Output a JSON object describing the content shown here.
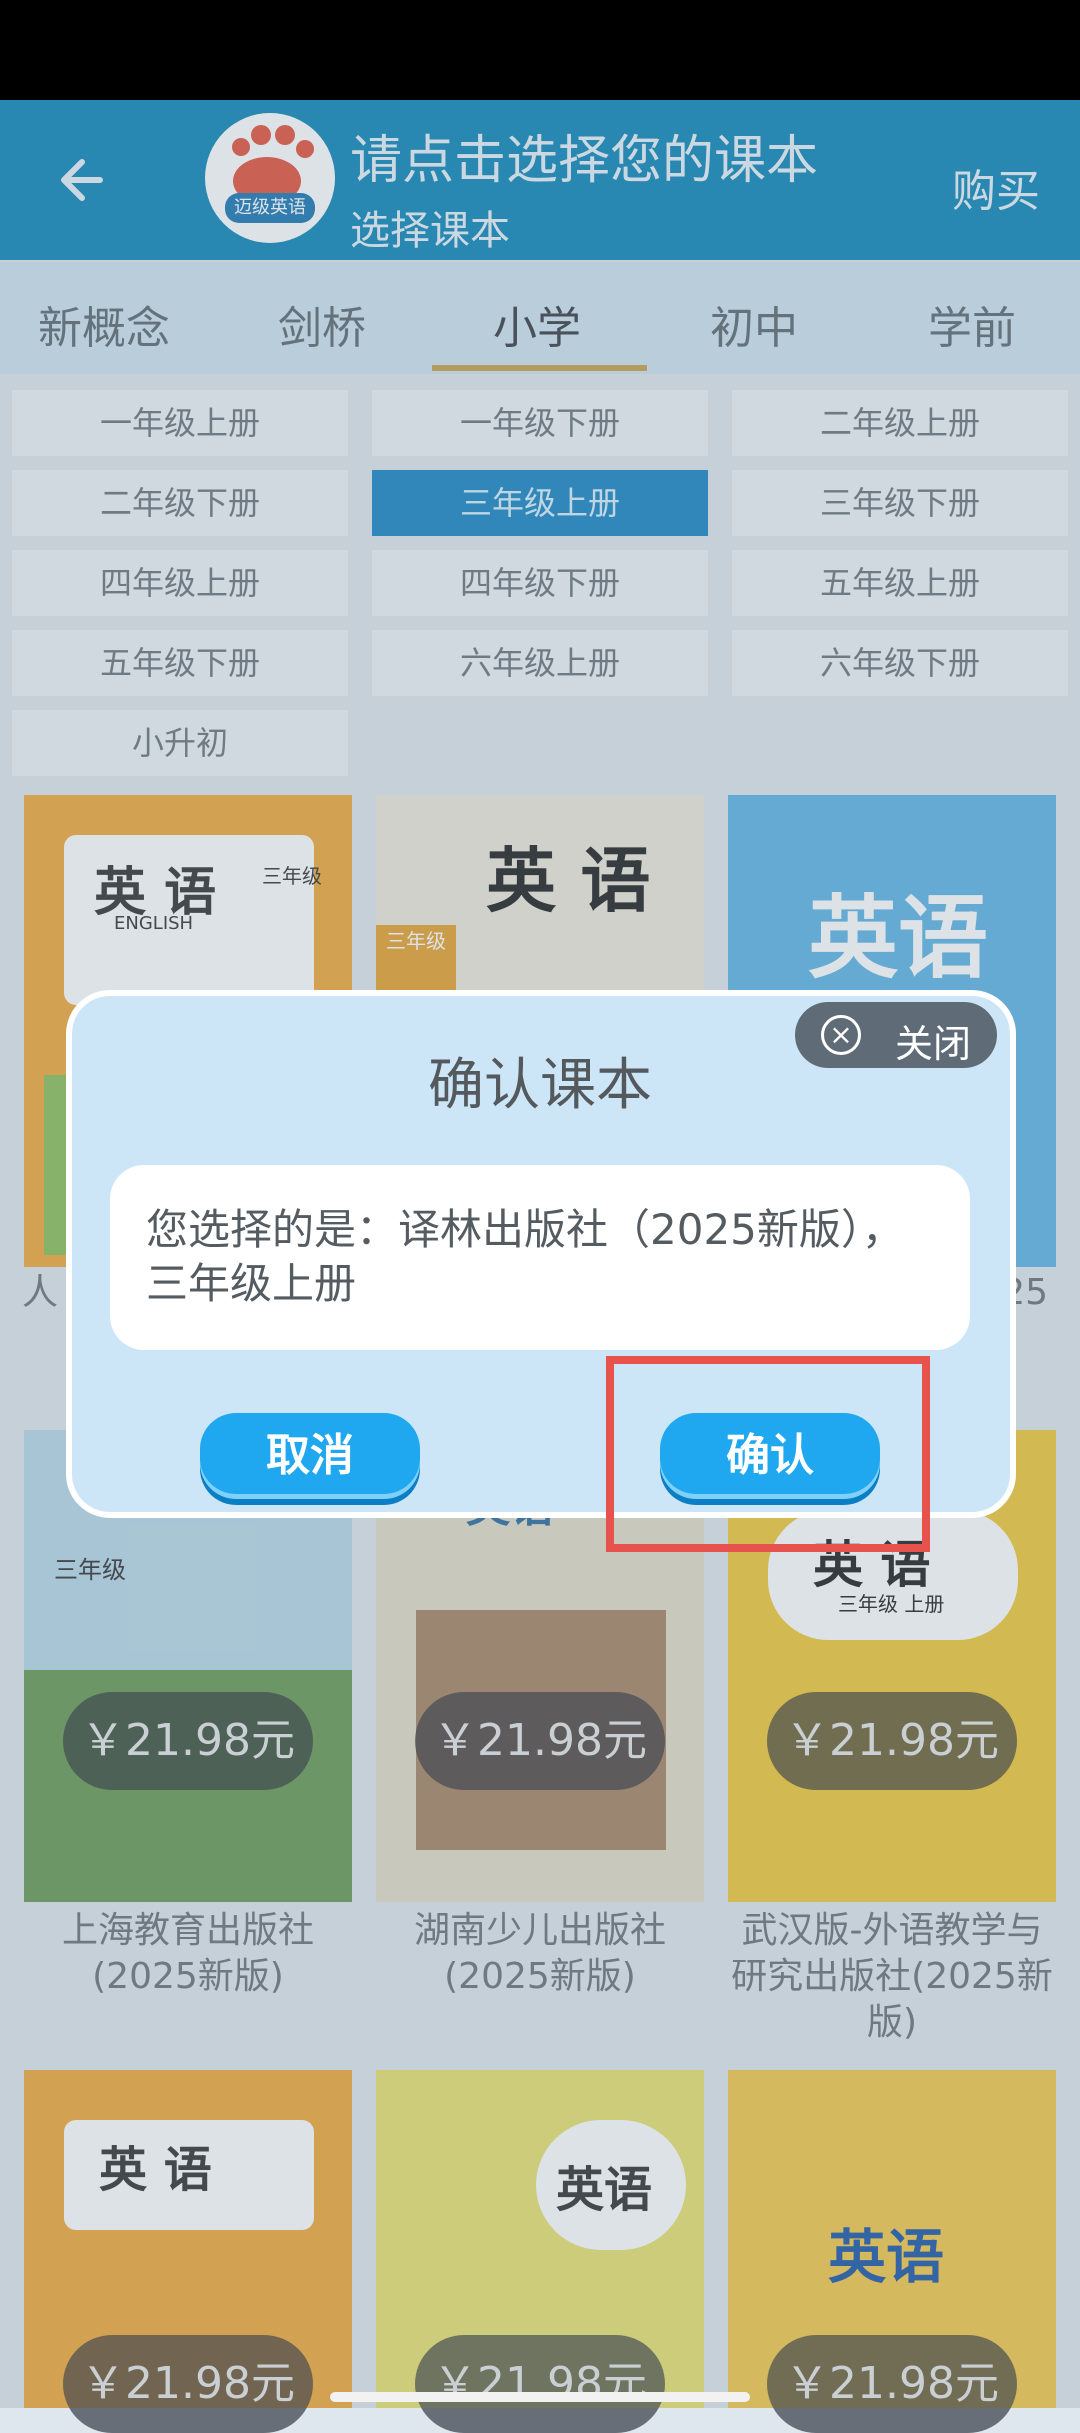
{
  "header": {
    "title": "请点击选择您的课本",
    "subtitle": "选择课本",
    "buy_label": "购买",
    "logo_text": "迈级英语"
  },
  "tabs": [
    "新概念",
    "剑桥",
    "小学",
    "初中",
    "学前"
  ],
  "active_tab": "小学",
  "grades": [
    "一年级上册",
    "一年级下册",
    "二年级上册",
    "二年级下册",
    "三年级上册",
    "三年级下册",
    "四年级上册",
    "四年级下册",
    "五年级上册",
    "五年级下册",
    "六年级上册",
    "六年级下册",
    "小升初"
  ],
  "selected_grade": "三年级上册",
  "books_row2": [
    {
      "publisher": "上海教育出版社(2025新版)",
      "price": "￥21.98元"
    },
    {
      "publisher": "湖南少儿出版社(2025新版)",
      "price": "￥21.98元"
    },
    {
      "publisher": "武汉版-外语教学与研究出版社(2025新版)",
      "price": "￥21.98元"
    }
  ],
  "books_row3": [
    {
      "price": "￥21.98元"
    },
    {
      "price": "￥21.98元"
    },
    {
      "price": "￥21.98元"
    }
  ],
  "row1_fragments": {
    "left": "人",
    "right": "25"
  },
  "covers": {
    "title": "英语",
    "title_spaced": "英 语",
    "english": "ENGLISH",
    "grade": "三年级",
    "term": "上册",
    "grade_term": "三年级 上册"
  },
  "dialog": {
    "title": "确认课本",
    "close_label": "关闭",
    "message": "您选择的是：译林出版社（2025新版），三年级上册",
    "cancel_label": "取消",
    "confirm_label": "确认"
  },
  "colors": {
    "header": "#0e87b8",
    "selected": "#1a86c5",
    "button": "#1fa8ef",
    "highlight": "#e8524c"
  }
}
